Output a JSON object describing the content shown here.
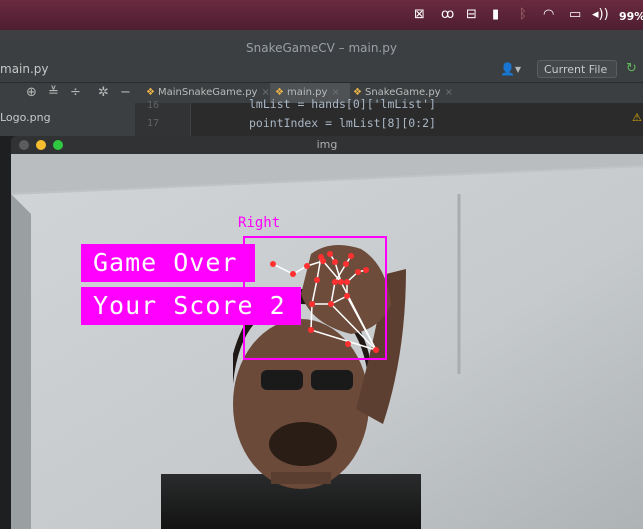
{
  "menubar": {
    "icons": [
      "screen-icon",
      "creative-cloud-icon",
      "mirror-icon",
      "flag-icon",
      "bluetooth-icon",
      "wifi-icon",
      "airplay-icon",
      "volume-icon"
    ],
    "battery_text": "99%"
  },
  "window": {
    "title": "SnakeGameCV – main.py"
  },
  "toolbar": {
    "project_file": "main.py",
    "current_file_label": "Current File ▾"
  },
  "tabs": [
    {
      "label": "MainSnakeGame.py",
      "active": false
    },
    {
      "label": "main.py",
      "active": true
    },
    {
      "label": "SnakeGame.py",
      "active": false
    }
  ],
  "project_panel": {
    "file": "Logo.png"
  },
  "editor": {
    "lines": [
      {
        "number": "16",
        "code": "lmList = hands[0]['lmList']"
      },
      {
        "number": "17",
        "code": "pointIndex = lmList[8][0:2]"
      }
    ]
  },
  "img_window": {
    "title": "img"
  },
  "overlay": {
    "game_over_text": "Game Over",
    "score_text": "Your Score 2",
    "hand_label": "Right"
  },
  "colors": {
    "accent": "#ff00ff",
    "menubar": "#5d2438",
    "ide_bg": "#3c3f41"
  }
}
